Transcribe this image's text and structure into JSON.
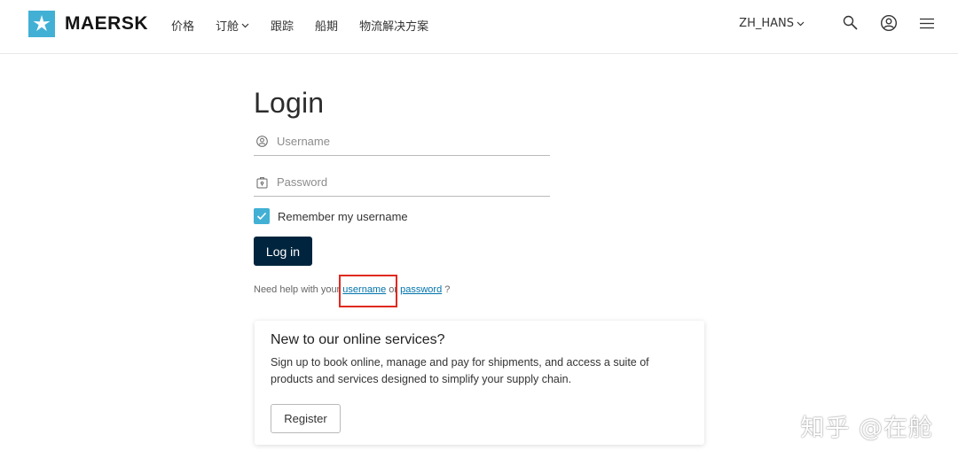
{
  "header": {
    "brand": "MAERSK",
    "nav": [
      {
        "label": "价格",
        "has_dropdown": false
      },
      {
        "label": "订舱",
        "has_dropdown": true
      },
      {
        "label": "跟踪",
        "has_dropdown": false
      },
      {
        "label": "船期",
        "has_dropdown": false
      },
      {
        "label": "物流解决方案",
        "has_dropdown": false
      }
    ],
    "language": "ZH_HANS",
    "icons": [
      "search-icon",
      "user-account-icon",
      "menu-icon"
    ]
  },
  "login": {
    "title": "Login",
    "username_placeholder": "Username",
    "username_value": "",
    "password_placeholder": "Password",
    "password_value": "",
    "remember_label": "Remember my username",
    "remember_checked": true,
    "submit_label": "Log in",
    "help_prefix": "Need help with your",
    "help_username": "username",
    "help_or": "or",
    "help_password": "password",
    "help_suffix": "?"
  },
  "card": {
    "title": "New to our online services?",
    "description": "Sign up to book online, manage and pay for shipments, and access a suite of products and services designed to simplify your supply chain.",
    "register_label": "Register"
  },
  "watermark": "知乎 @在舱",
  "colors": {
    "brand_blue": "#42b0d5",
    "primary_button": "#00243d",
    "link": "#0073ab",
    "highlight": "#e02a1f"
  }
}
